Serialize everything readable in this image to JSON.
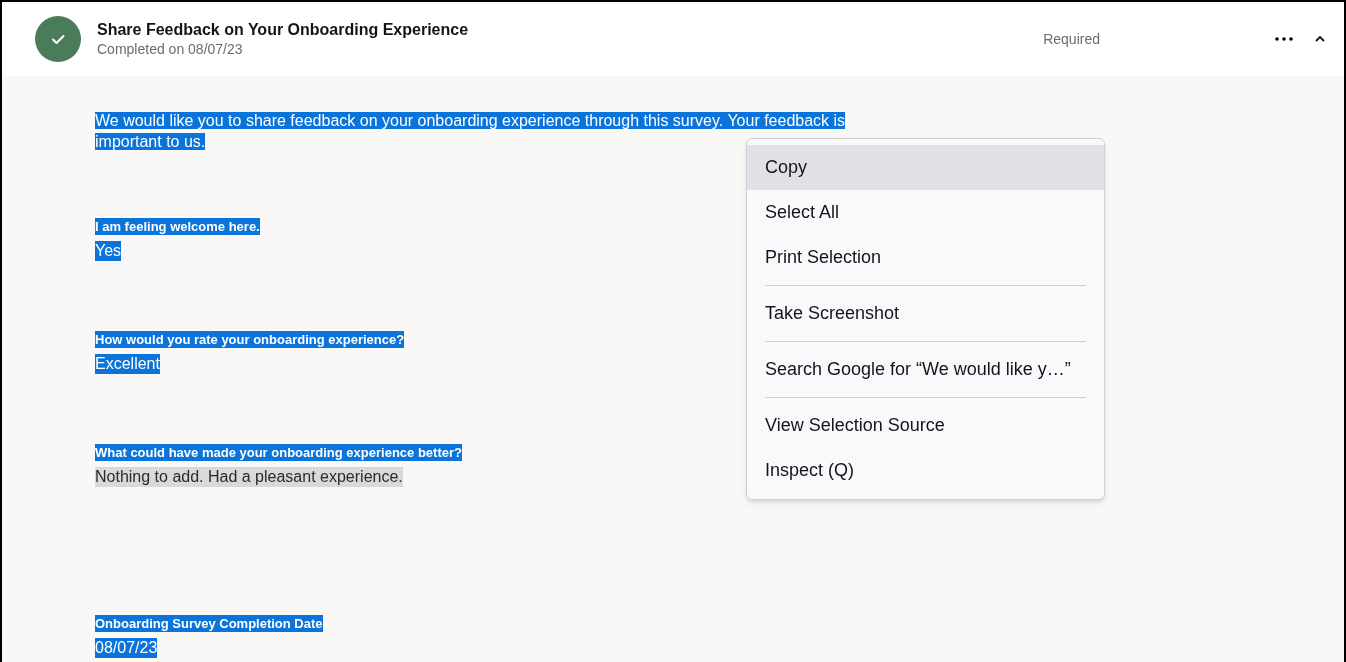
{
  "header": {
    "completed": true,
    "title": "Share Feedback on Your Onboarding Experience",
    "subtitle": "Completed on 08/07/23",
    "badge": "Required",
    "expanded": true
  },
  "intro": {
    "text": "We would like you to share feedback on your onboarding experience through this survey. Your feedback is important to us.",
    "selected": true,
    "active": true
  },
  "questions": [
    {
      "label": "I am feeling welcome here.",
      "label_selected": true,
      "answer": "Yes",
      "answer_selected": true,
      "answer_active": true
    },
    {
      "label": "How would you rate your onboarding experience?",
      "label_selected": true,
      "answer": "Excellent",
      "answer_selected": true,
      "answer_active": true
    },
    {
      "label": "What could have made your onboarding experience better?",
      "label_selected": true,
      "answer": "Nothing to add. Had a pleasant experience.",
      "answer_selected": true,
      "answer_active": false
    },
    {
      "label": "Onboarding Survey Completion Date",
      "label_selected": true,
      "answer": "08/07/23",
      "answer_selected": true,
      "answer_active": true
    }
  ],
  "context_menu": [
    {
      "kind": "item",
      "label": "Copy",
      "selected": true
    },
    {
      "kind": "item",
      "label": "Select All",
      "selected": false
    },
    {
      "kind": "item",
      "label": "Print Selection",
      "selected": false
    },
    {
      "kind": "separator"
    },
    {
      "kind": "item",
      "label": "Take Screenshot",
      "selected": false
    },
    {
      "kind": "separator"
    },
    {
      "kind": "item",
      "label": "Search Google for “We would like y…”",
      "selected": false
    },
    {
      "kind": "separator"
    },
    {
      "kind": "item",
      "label": "View Selection Source",
      "selected": false
    },
    {
      "kind": "item",
      "label": "Inspect (Q)",
      "selected": false
    }
  ]
}
